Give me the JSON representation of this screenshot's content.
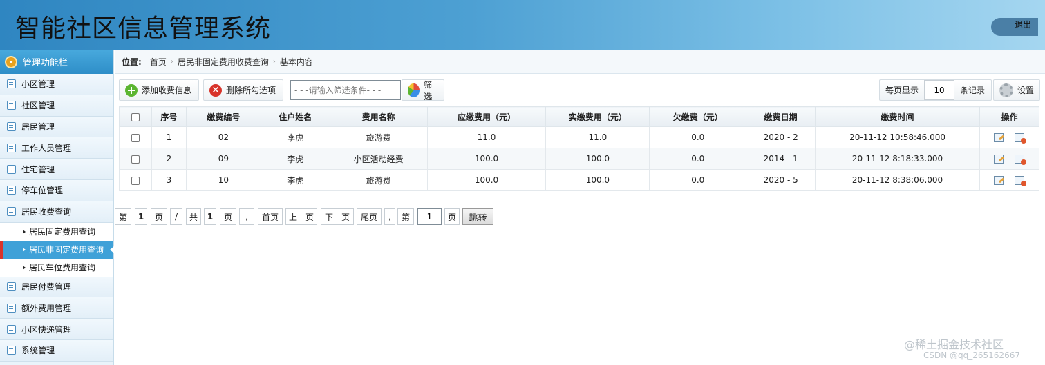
{
  "app": {
    "title": "智能社区信息管理系统",
    "logout": "退出"
  },
  "sidebar": {
    "header": "管理功能栏",
    "items_top": [
      {
        "label": "小区管理"
      },
      {
        "label": "社区管理"
      },
      {
        "label": "居民管理"
      },
      {
        "label": "工作人员管理"
      },
      {
        "label": "住宅管理"
      },
      {
        "label": "停车位管理"
      },
      {
        "label": "居民收费查询"
      }
    ],
    "sub_items": [
      {
        "label": "居民固定费用查询"
      },
      {
        "label": "居民非固定费用查询"
      },
      {
        "label": "居民车位费用查询"
      }
    ],
    "items_bottom": [
      {
        "label": "居民付费管理"
      },
      {
        "label": "额外费用管理"
      },
      {
        "label": "小区快递管理"
      },
      {
        "label": "系统管理"
      }
    ]
  },
  "breadcrumb": {
    "label": "位置:",
    "items": [
      "首页",
      "居民非固定费用收费查询",
      "基本内容"
    ]
  },
  "toolbar": {
    "add": "添加收费信息",
    "delete": "删除所勾选项",
    "search_placeholder": "- - -请输入筛选条件- - -",
    "filter": "筛选",
    "per_page_label": "每页显示",
    "per_page_value": "10",
    "records_label": "条记录",
    "settings": "设置"
  },
  "table": {
    "columns": [
      "序号",
      "缴费编号",
      "住户姓名",
      "费用名称",
      "应缴费用（元）",
      "实缴费用（元）",
      "欠缴费（元）",
      "缴费日期",
      "缴费时间",
      "操作"
    ],
    "rows": [
      [
        "1",
        "02",
        "李虎",
        "旅游费",
        "11.0",
        "11.0",
        "0.0",
        "2020 - 2",
        "20-11-12 10:58:46.000"
      ],
      [
        "2",
        "09",
        "李虎",
        "小区活动经费",
        "100.0",
        "100.0",
        "0.0",
        "2014 - 1",
        "20-11-12 8:18:33.000"
      ],
      [
        "3",
        "10",
        "李虎",
        "旅游费",
        "100.0",
        "100.0",
        "0.0",
        "2020 - 5",
        "20-11-12 8:38:06.000"
      ]
    ]
  },
  "pager": {
    "di": "第",
    "page": "1",
    "ye": "页",
    "slash": "/",
    "gong": "共",
    "total": "1",
    "ye2": "页",
    "comma": ",",
    "first": "首页",
    "prev": "上一页",
    "next": "下一页",
    "last": "尾页",
    "comma2": ",",
    "di2": "第",
    "jump_value": "1",
    "ye3": "页",
    "go": "跳转"
  },
  "watermark": {
    "line1": "@稀土掘金技术社区",
    "line2": "CSDN @qq_265162667"
  }
}
